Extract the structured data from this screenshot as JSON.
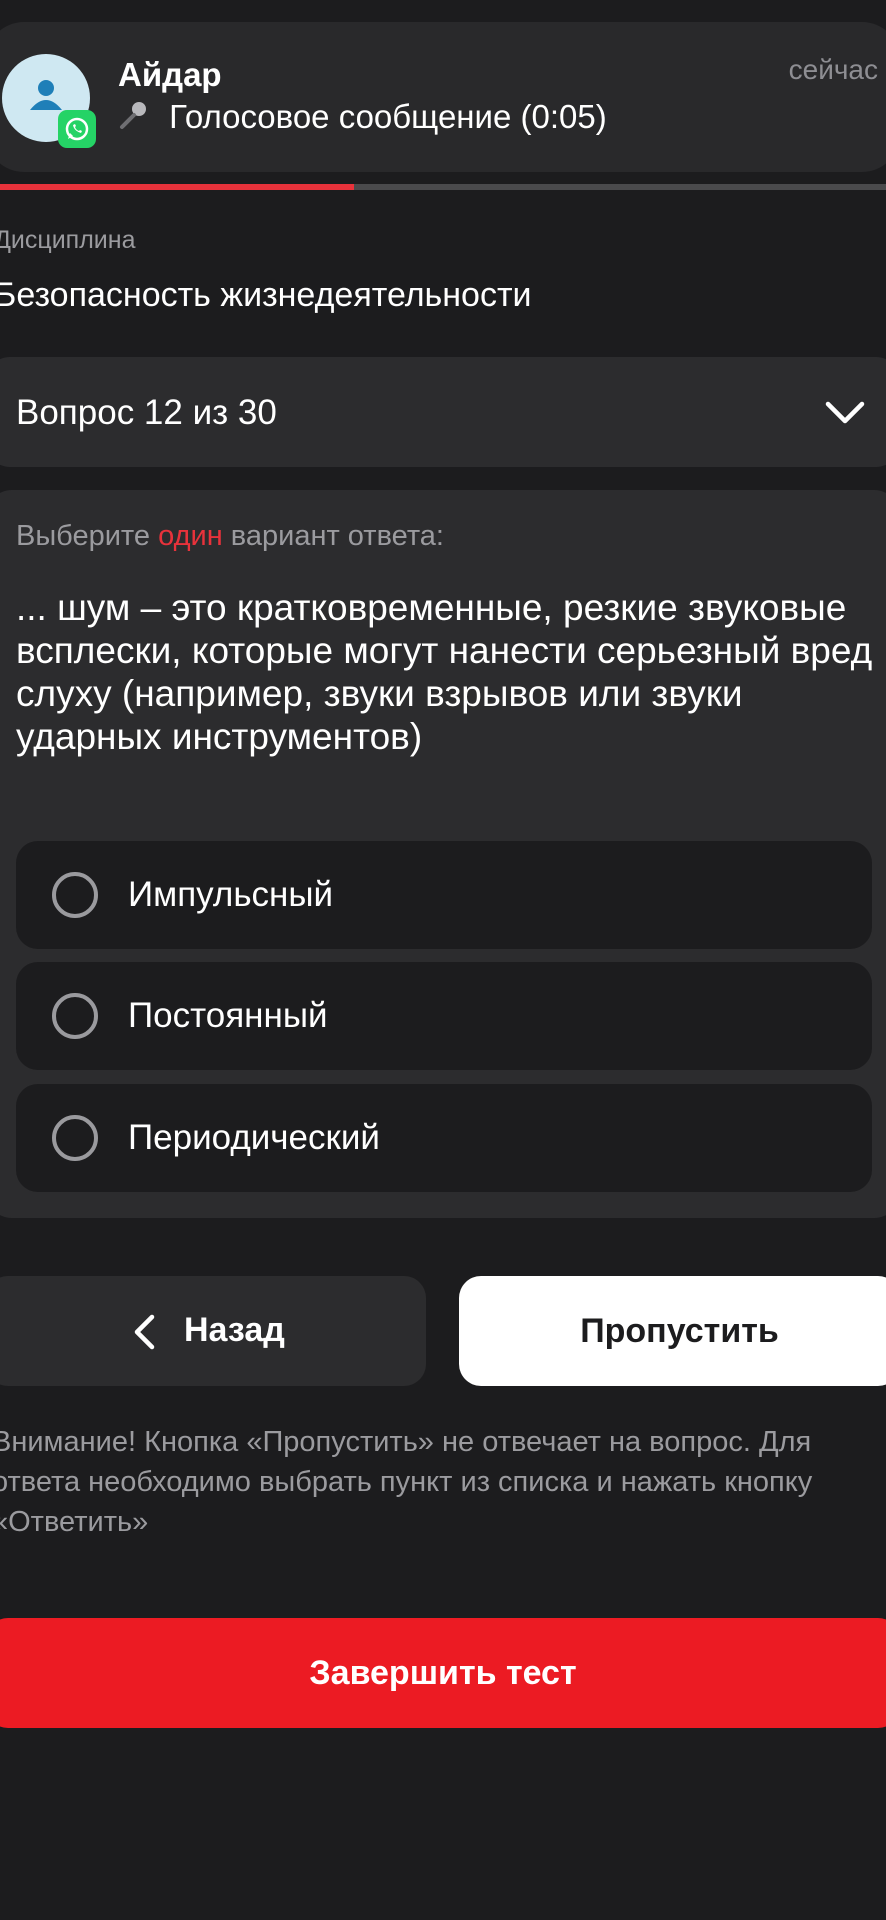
{
  "notification": {
    "sender": "Айдар",
    "message": "Голосовое сообщение (0:05)",
    "time": "сейчас",
    "app_icon": "whatsapp-icon",
    "message_icon": "microphone-icon"
  },
  "progress": {
    "current": 12,
    "total": 30,
    "color": "#e8323b"
  },
  "discipline": {
    "label": "Дисциплина",
    "value": "Безопасность жизнедеятельности"
  },
  "question_selector": {
    "label": "Вопрос 12 из 30"
  },
  "question": {
    "instruction_before": "Выберите ",
    "instruction_accent": "один",
    "instruction_after": " вариант ответа:",
    "text": "... шум – это кратковременные, резкие звуковые всплески, которые могут нанести серьезный вред слуху (например, звуки взрывов или звуки ударных инструментов)",
    "options": [
      {
        "label": "Импульсный",
        "selected": false
      },
      {
        "label": "Постоянный",
        "selected": false
      },
      {
        "label": "Периодический",
        "selected": false
      }
    ]
  },
  "buttons": {
    "back": "Назад",
    "skip": "Пропустить",
    "finish": "Завершить тест"
  },
  "notice": "Внимание! Кнопка «Пропустить» не отвечает на вопрос. Для ответа необходимо выбрать пункт из списка и нажать кнопку «Ответить»",
  "colors": {
    "background": "#1c1c1e",
    "card": "#2c2c2e",
    "accent_red": "#ec1b23"
  }
}
